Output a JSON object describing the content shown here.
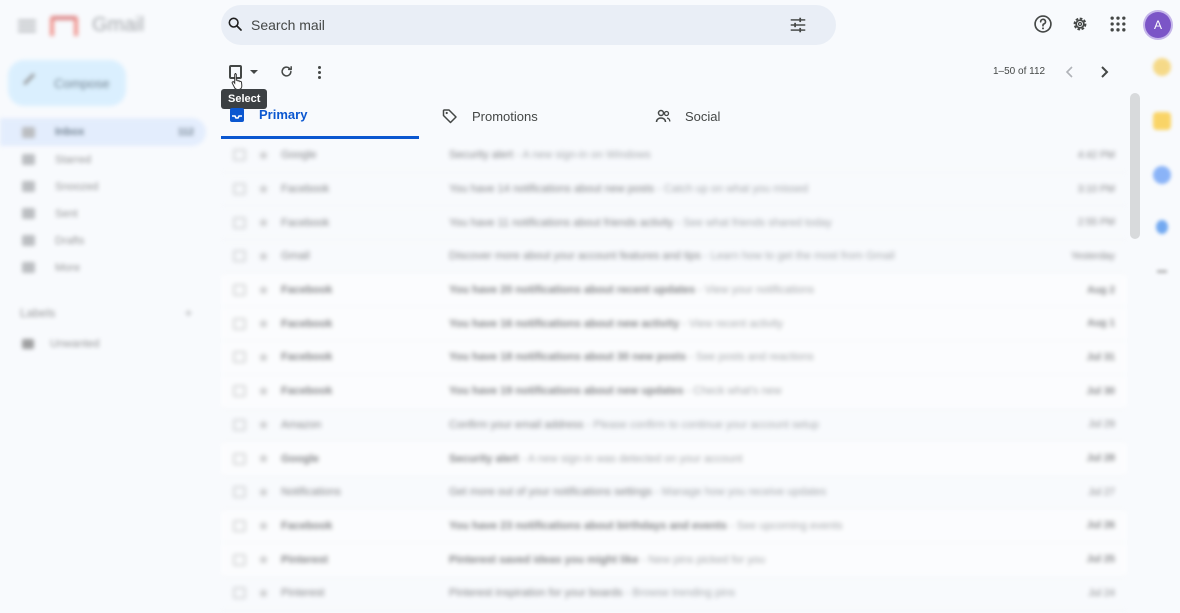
{
  "sidebar": {
    "brand": "Gmail",
    "compose_label": "Compose",
    "nav": [
      {
        "label": "Inbox",
        "count": "112",
        "active": true
      },
      {
        "label": "Starred",
        "count": ""
      },
      {
        "label": "Snoozed",
        "count": ""
      },
      {
        "label": "Sent",
        "count": ""
      },
      {
        "label": "Drafts",
        "count": ""
      },
      {
        "label": "More",
        "count": ""
      }
    ],
    "labels_heading": "Labels",
    "labels_add": "+",
    "label_items": [
      "Unwanted"
    ]
  },
  "search": {
    "placeholder": "Search mail"
  },
  "header": {
    "avatar_initial": "A"
  },
  "toolbar": {
    "tooltip": "Select",
    "page_range": "1–50 of 112"
  },
  "tabs": [
    {
      "label": "Primary",
      "icon": "inbox-icon",
      "active": true
    },
    {
      "label": "Promotions",
      "icon": "tag-icon"
    },
    {
      "label": "Social",
      "icon": "people-icon"
    }
  ],
  "emails": [
    {
      "sender": "Google",
      "subject": "Security alert",
      "snippet": " - A new sign-in on Windows",
      "date": "4:42 PM",
      "unread": false
    },
    {
      "sender": "Facebook",
      "subject": "You have 14 notifications about new posts",
      "snippet": " - Catch up on what you missed",
      "date": "3:10 PM",
      "unread": false
    },
    {
      "sender": "Facebook",
      "subject": "You have 11 notifications about friends activity",
      "snippet": " - See what friends shared today",
      "date": "2:55 PM",
      "unread": false
    },
    {
      "sender": "Gmail",
      "subject": "Discover more about your account features and tips",
      "snippet": " - Learn how to get the most from Gmail",
      "date": "Yesterday",
      "unread": false
    },
    {
      "sender": "Facebook",
      "subject": "You have 20 notifications about recent updates",
      "snippet": " - View your notifications",
      "date": "Aug 2",
      "unread": true
    },
    {
      "sender": "Facebook",
      "subject": "You have 16 notifications about new activity",
      "snippet": " - View recent activity",
      "date": "Aug 1",
      "unread": true
    },
    {
      "sender": "Facebook",
      "subject": "You have 18 notifications about 30 new posts",
      "snippet": " - See posts and reactions",
      "date": "Jul 31",
      "unread": true
    },
    {
      "sender": "Facebook",
      "subject": "You have 19 notifications about new updates",
      "snippet": " - Check what's new",
      "date": "Jul 30",
      "unread": true
    },
    {
      "sender": "Amazon",
      "subject": "Confirm your email address",
      "snippet": " - Please confirm to continue your account setup",
      "date": "Jul 29",
      "unread": false
    },
    {
      "sender": "Google",
      "subject": "Security alert",
      "snippet": " - A new sign-in was detected on your account",
      "date": "Jul 28",
      "unread": true
    },
    {
      "sender": "Notifications",
      "subject": "Get more out of your notifications settings",
      "snippet": " - Manage how you receive updates",
      "date": "Jul 27",
      "unread": false
    },
    {
      "sender": "Facebook",
      "subject": "You have 23 notifications about birthdays and events",
      "snippet": " - See upcoming events",
      "date": "Jul 26",
      "unread": true
    },
    {
      "sender": "Pinterest",
      "subject": "Pinterest saved ideas you might like",
      "snippet": " - New pins picked for you",
      "date": "Jul 25",
      "unread": true
    },
    {
      "sender": "Pinterest",
      "subject": "Pinterest inspiration for your boards",
      "snippet": " - Browse trending pins",
      "date": "Jul 24",
      "unread": false
    }
  ],
  "colors": {
    "accent": "#0b57d0",
    "search_bg": "#e9eef6",
    "compose_bg": "#c2e7ff",
    "avatar_bg": "#7b55c7"
  }
}
